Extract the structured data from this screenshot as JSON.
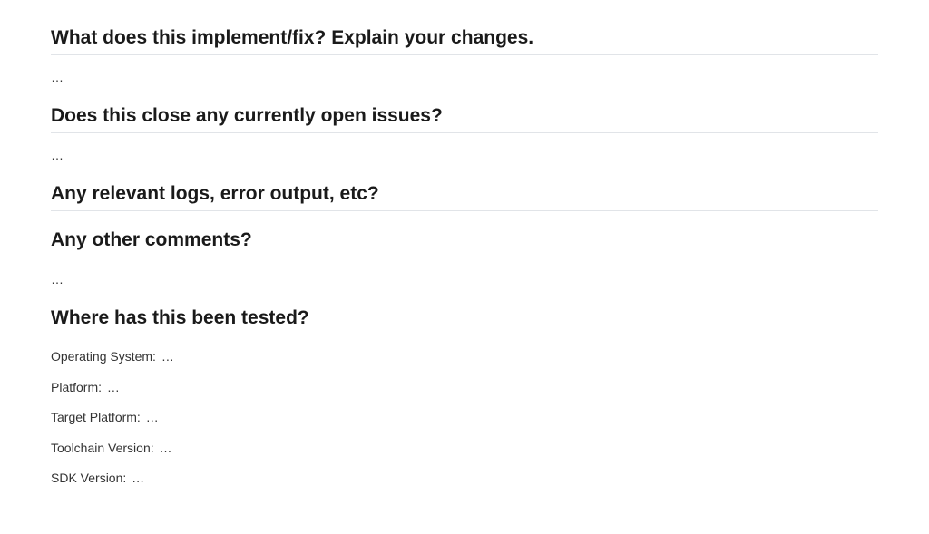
{
  "sections": {
    "implement": {
      "heading": "What does this implement/fix? Explain your changes.",
      "body": "…"
    },
    "closes_issues": {
      "heading": "Does this close any currently open issues?",
      "body": "…"
    },
    "logs": {
      "heading": "Any relevant logs, error output, etc?"
    },
    "comments": {
      "heading": "Any other comments?",
      "body": "…"
    },
    "tested": {
      "heading": "Where has this been tested?",
      "fields": {
        "os": {
          "label": "Operating System:",
          "value": "…"
        },
        "platform": {
          "label": "Platform:",
          "value": "…"
        },
        "target_platform": {
          "label": "Target Platform:",
          "value": "…"
        },
        "toolchain": {
          "label": "Toolchain Version:",
          "value": "…"
        },
        "sdk": {
          "label": "SDK Version:",
          "value": "…"
        }
      }
    }
  }
}
